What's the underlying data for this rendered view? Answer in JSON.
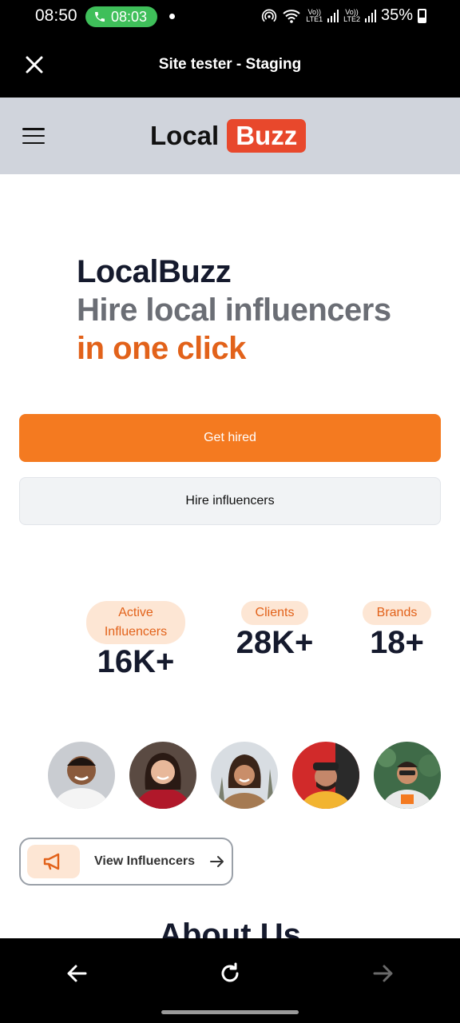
{
  "status_bar": {
    "time": "08:50",
    "call_timer": "08:03",
    "signal_1_label": "Vo))\nLTE1",
    "signal_2_label": "Vo))\nLTE2",
    "battery": "35%"
  },
  "app_bar": {
    "title": "Site tester - Staging",
    "close_icon": "close-icon"
  },
  "site_header": {
    "logo_part1": "Local",
    "logo_part2": "Buzz",
    "menu_icon": "hamburger-icon",
    "colors": {
      "header_bg": "#d0d4dc",
      "logo_badge": "#e8482c"
    }
  },
  "hero": {
    "line1": "LocalBuzz",
    "line2": "Hire local influencers",
    "line3": "in one click"
  },
  "buttons": {
    "primary": "Get hired",
    "secondary": "Hire influencers",
    "colors": {
      "primary": "#f47a20"
    }
  },
  "stats": [
    {
      "label": "Active Influencers",
      "value": "16K+"
    },
    {
      "label": "Clients",
      "value": "28K+"
    },
    {
      "label": "Brands",
      "value": "18+"
    }
  ],
  "avatars": [
    "avatar-man-white-shirt",
    "avatar-woman-red-top",
    "avatar-woman-curly-hair",
    "avatar-man-yellow-shirt",
    "avatar-man-sunglasses"
  ],
  "view_influencers": {
    "label": "View Influencers",
    "icon": "megaphone-icon",
    "arrow": "arrow-right-icon"
  },
  "about": {
    "heading": "About Us"
  },
  "bottom_nav": {
    "back": "arrow-left-icon",
    "reload": "reload-icon",
    "forward": "arrow-right-icon"
  }
}
